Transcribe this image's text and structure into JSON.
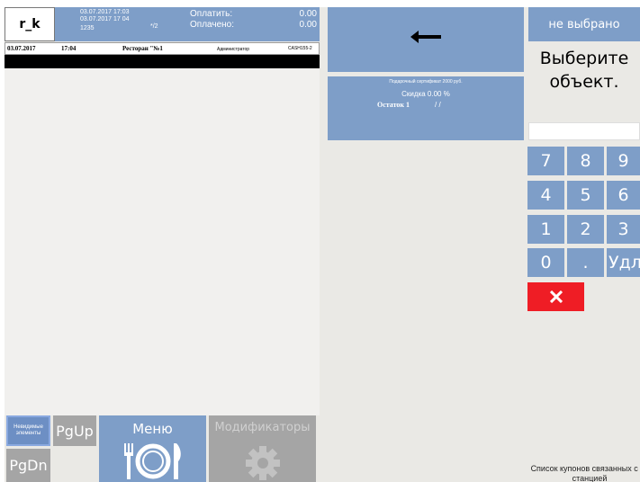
{
  "header": {
    "user": "r_k",
    "order_opened": "03.07.2017 17:03",
    "order_time2": "03.07.2017 17 04",
    "order_number": "1235",
    "order_suffix": "*/2",
    "to_pay_label": "Оплатить:",
    "to_pay_value": "0.00",
    "paid_label": "Оплачено:",
    "paid_value": "0.00"
  },
  "date_row": {
    "date": "03.07.2017",
    "time": "17:04",
    "restaurant": "Ресторан \"№1",
    "role": "Администратор",
    "cashier": "CASH155-2"
  },
  "bottom": {
    "hidden_elements": "Невидимые элементы",
    "pgup": "PgUp",
    "pgdn": "PgDn",
    "menu": "Меню",
    "modifiers": "Модификаторы"
  },
  "coupon": {
    "title": "Подарочный сертификат 2000 руб.",
    "discount": "Скидка 0.00 %",
    "remainder": "Остаток 1",
    "slashes": "/ /"
  },
  "right": {
    "not_selected": "не выбрано",
    "prompt_line1": "Выберите",
    "prompt_line2": "объект.",
    "keys": [
      "7",
      "8",
      "9",
      "4",
      "5",
      "6",
      "1",
      "2",
      "3",
      "0",
      ".",
      "Удл"
    ],
    "coupons_caption_line1": "Список купонов связанных с ка",
    "coupons_caption_line2": "станцией"
  },
  "colors": {
    "tile_blue": "#7e9ec8",
    "tile_gray": "#a5a5a5",
    "cancel_red": "#ef1d25",
    "background": "#eae9e5"
  },
  "icons": {
    "back": "left-arrow-icon",
    "menu": "plate-fork-knife-icon",
    "modifiers": "gear-icon",
    "cancel": "x-icon"
  }
}
